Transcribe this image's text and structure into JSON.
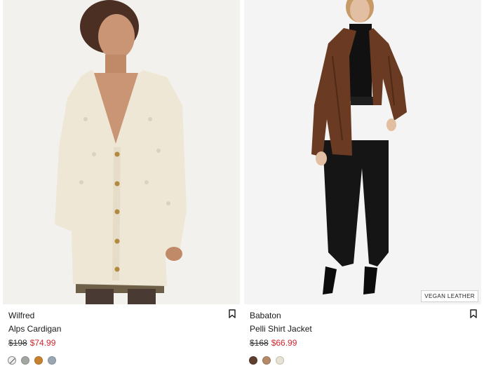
{
  "products": [
    {
      "brand": "Wilfred",
      "name": "Alps Cardigan",
      "original_price": "$198",
      "sale_price": "$74.99",
      "badge": "",
      "swatches": [
        "pattern",
        "#a3a7a1",
        "#c8812e",
        "#9aa6b2"
      ]
    },
    {
      "brand": "Babaton",
      "name": "Pelli Shirt Jacket",
      "original_price": "$168",
      "sale_price": "$66.99",
      "badge": "VEGAN LEATHER",
      "swatches": [
        "#5e3e2f",
        "#b48a68",
        "#e7e2d4"
      ]
    }
  ],
  "colors": {
    "sale": "#d0262f",
    "text": "#1a1a1a"
  },
  "icons": {
    "bookmark": "bookmark-icon"
  }
}
